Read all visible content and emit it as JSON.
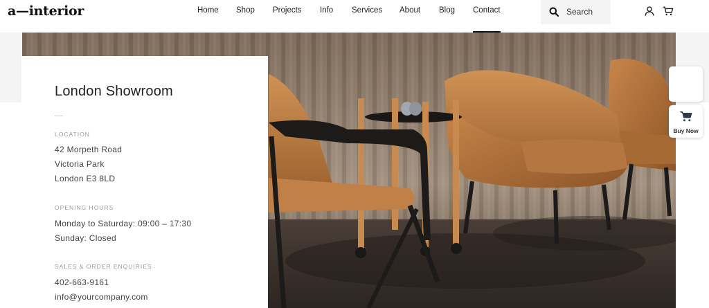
{
  "brand": {
    "logo_text": "a—interior"
  },
  "nav": {
    "items": [
      {
        "label": "Home"
      },
      {
        "label": "Shop"
      },
      {
        "label": "Projects"
      },
      {
        "label": "Info"
      },
      {
        "label": "Services"
      },
      {
        "label": "About"
      },
      {
        "label": "Blog"
      },
      {
        "label": "Contact",
        "active": true
      }
    ]
  },
  "search": {
    "label": "Search",
    "icon": "search-icon"
  },
  "header_icons": [
    "user-icon",
    "cart-icon"
  ],
  "showroom": {
    "title": "London Showroom",
    "location": {
      "label": "LOCATION",
      "lines": [
        "42 Morpeth Road",
        "Victoria Park",
        "London E3 8LD"
      ]
    },
    "hours": {
      "label": "OPENING HOURS",
      "lines": [
        "Monday to Saturday: 09:00 – 17:30",
        "Sunday: Closed"
      ]
    },
    "enquiries": {
      "label": "SALES & ORDER ENQUIRIES",
      "lines": [
        "402-663-9161",
        "info@yourcompany.com"
      ]
    }
  },
  "side_widgets": {
    "buy_now_label": "Buy Now",
    "buy_icon": "cart-icon"
  },
  "colors": {
    "accent": "#111111",
    "chair_leather": "#b8763c",
    "curtain": "#a89684",
    "carpet": "#3e3530"
  }
}
